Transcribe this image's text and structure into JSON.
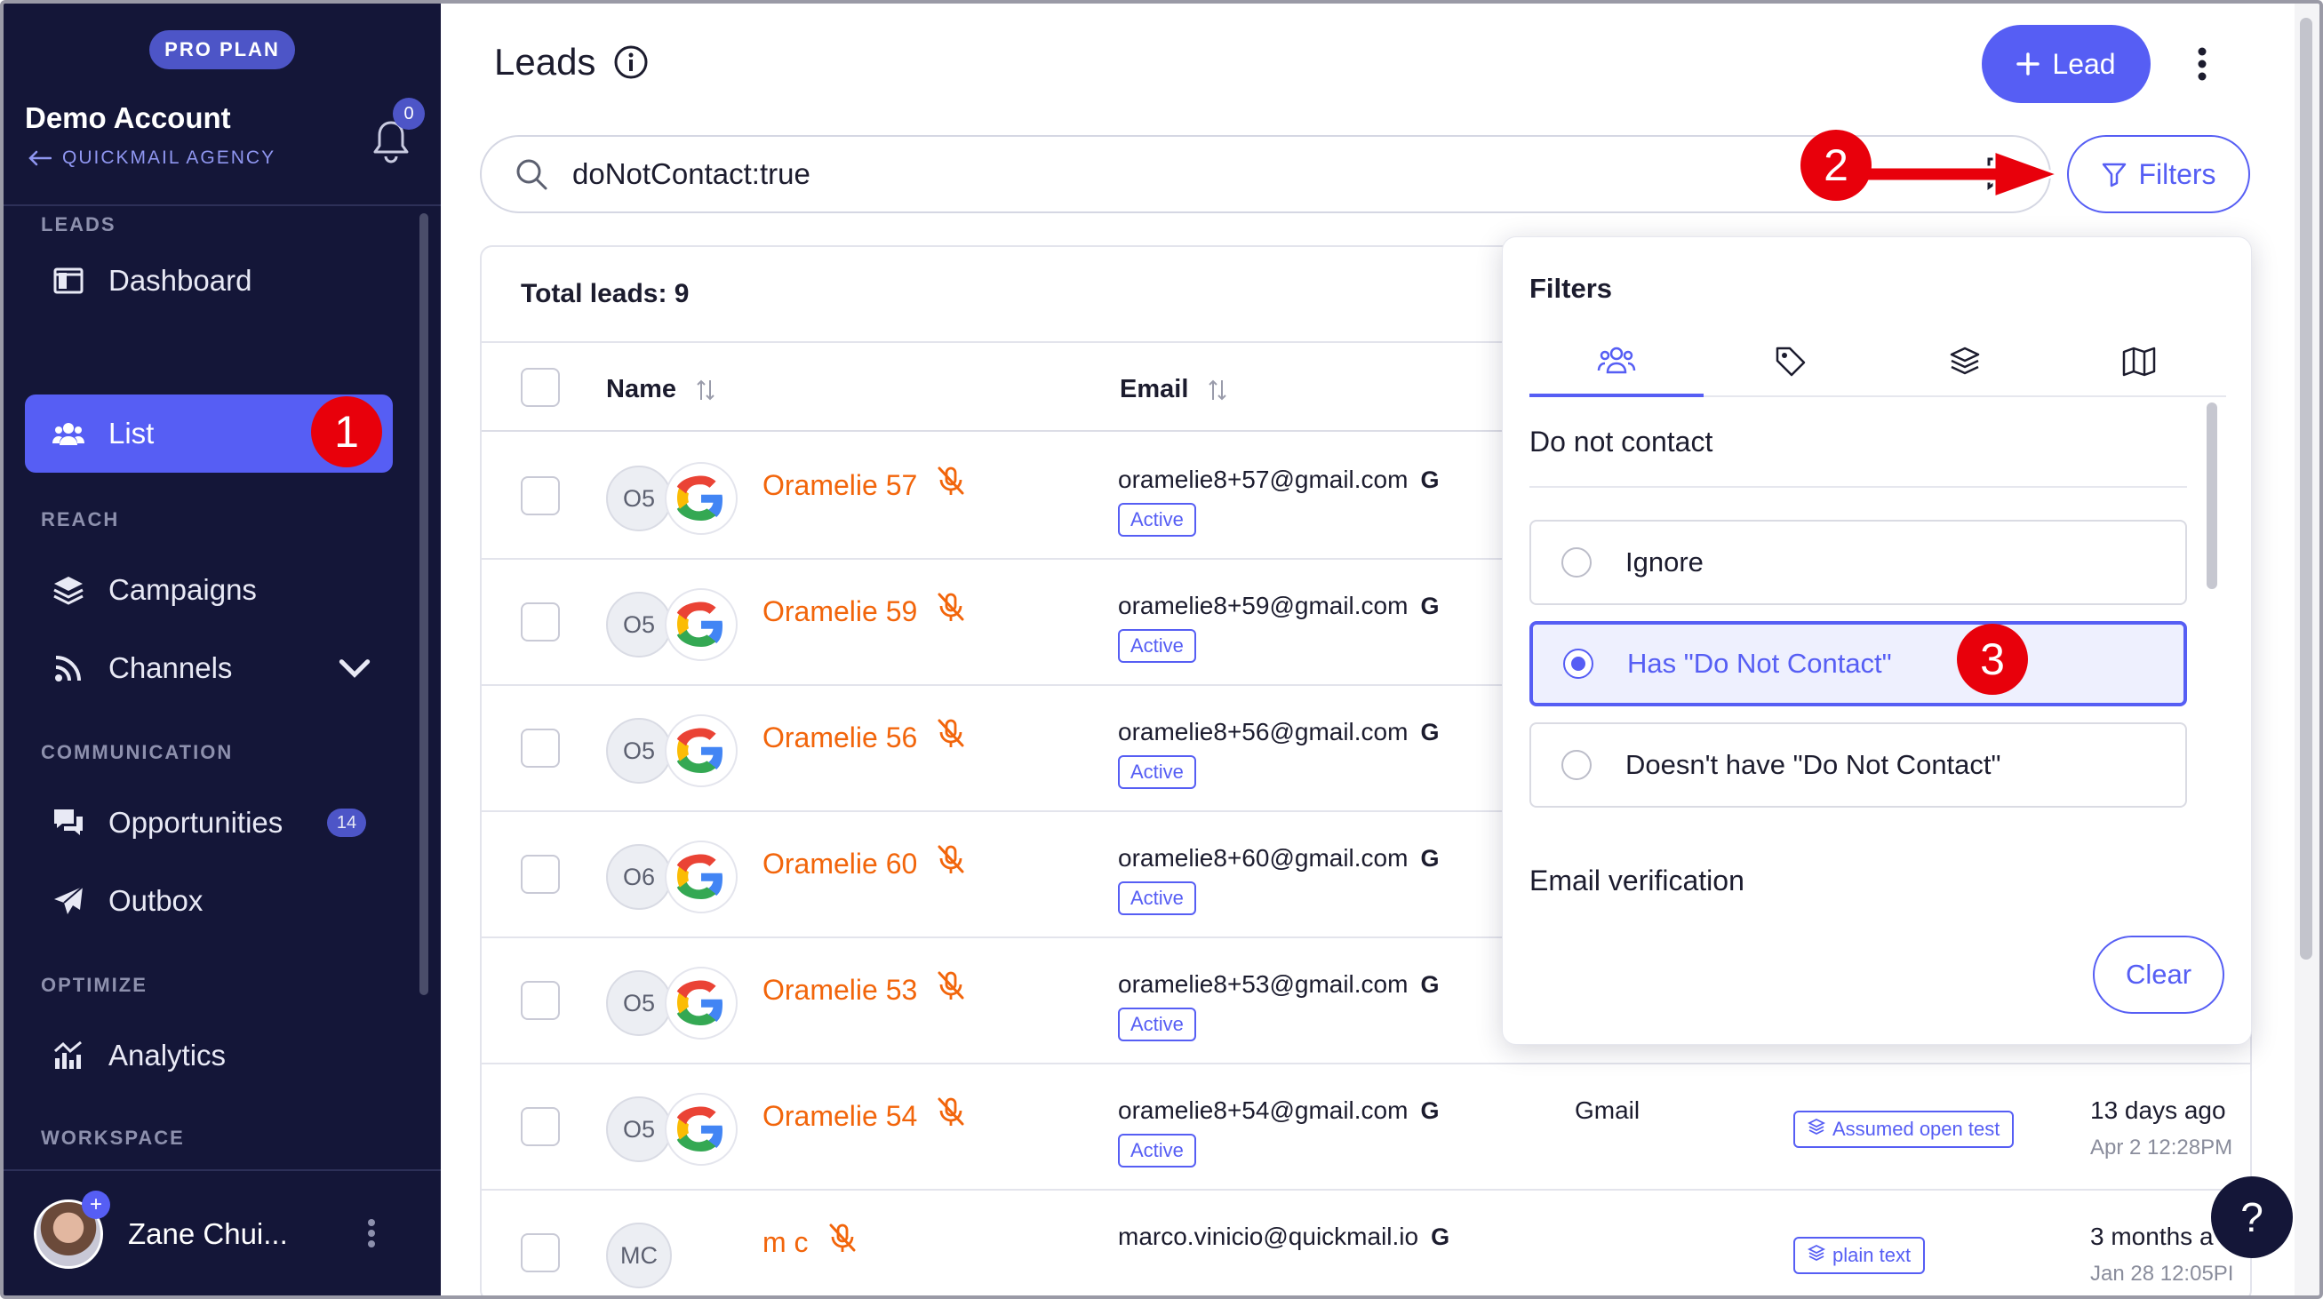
{
  "sidebar": {
    "plan_badge": "PRO PLAN",
    "account_name": "Demo Account",
    "agency_link": "QUICKMAIL AGENCY",
    "notification_count": "0",
    "sections": {
      "leads": "LEADS",
      "reach": "REACH",
      "communication": "COMMUNICATION",
      "optimize": "OPTIMIZE",
      "workspace": "WORKSPACE"
    },
    "items": {
      "dashboard": "Dashboard",
      "list": "List",
      "campaigns": "Campaigns",
      "channels": "Channels",
      "opportunities": "Opportunities",
      "opportunities_count": "14",
      "outbox": "Outbox",
      "analytics": "Analytics"
    },
    "user_name": "Zane Chui..."
  },
  "header": {
    "title": "Leads",
    "lead_button": "Lead"
  },
  "search": {
    "value": "doNotContact:true"
  },
  "filters_button": "Filters",
  "table": {
    "total": "Total leads: 9",
    "columns": {
      "name": "Name",
      "email": "Email"
    },
    "rows": [
      {
        "initials": "O5",
        "name": "Oramelie 57",
        "email": "oramelie8+57@gmail.com",
        "status": "Active",
        "provider": "",
        "tag": "",
        "when": "",
        "when_detail": ""
      },
      {
        "initials": "O5",
        "name": "Oramelie 59",
        "email": "oramelie8+59@gmail.com",
        "status": "Active",
        "provider": "",
        "tag": "",
        "when": "",
        "when_detail": ""
      },
      {
        "initials": "O5",
        "name": "Oramelie 56",
        "email": "oramelie8+56@gmail.com",
        "status": "Active",
        "provider": "",
        "tag": "",
        "when": "",
        "when_detail": ""
      },
      {
        "initials": "O6",
        "name": "Oramelie 60",
        "email": "oramelie8+60@gmail.com",
        "status": "Active",
        "provider": "",
        "tag": "",
        "when": "",
        "when_detail": ""
      },
      {
        "initials": "O5",
        "name": "Oramelie 53",
        "email": "oramelie8+53@gmail.com",
        "status": "Active",
        "provider": "",
        "tag": "",
        "when": "",
        "when_detail": ""
      },
      {
        "initials": "O5",
        "name": "Oramelie 54",
        "email": "oramelie8+54@gmail.com",
        "status": "Active",
        "provider": "Gmail",
        "tag": "Assumed open test",
        "when": "13 days ago",
        "when_detail": "Apr 2 12:28PM"
      },
      {
        "initials": "MC",
        "name": "m c",
        "email": "marco.vinicio@quickmail.io",
        "status": "",
        "provider": "",
        "tag": "plain text",
        "when": "3 months a",
        "when_detail": "Jan 28 12:05PI"
      }
    ]
  },
  "filter_panel": {
    "title": "Filters",
    "tab_icons": [
      "people-icon",
      "tag-icon",
      "layers-icon",
      "map-icon"
    ],
    "group_label": "Do not contact",
    "options": [
      "Ignore",
      "Has \"Do Not Contact\"",
      "Doesn't have \"Do Not Contact\""
    ],
    "selected_option": "Has \"Do Not Contact\"",
    "next_group_label": "Email verification",
    "clear_button": "Clear"
  },
  "annotations": {
    "step1": "1",
    "step2": "2",
    "step3": "3"
  },
  "help_button": "?",
  "colors": {
    "accent": "#565ef4",
    "sidebar_bg": "#141638",
    "lead_name": "#f2650b",
    "annotation": "#e8000b"
  }
}
